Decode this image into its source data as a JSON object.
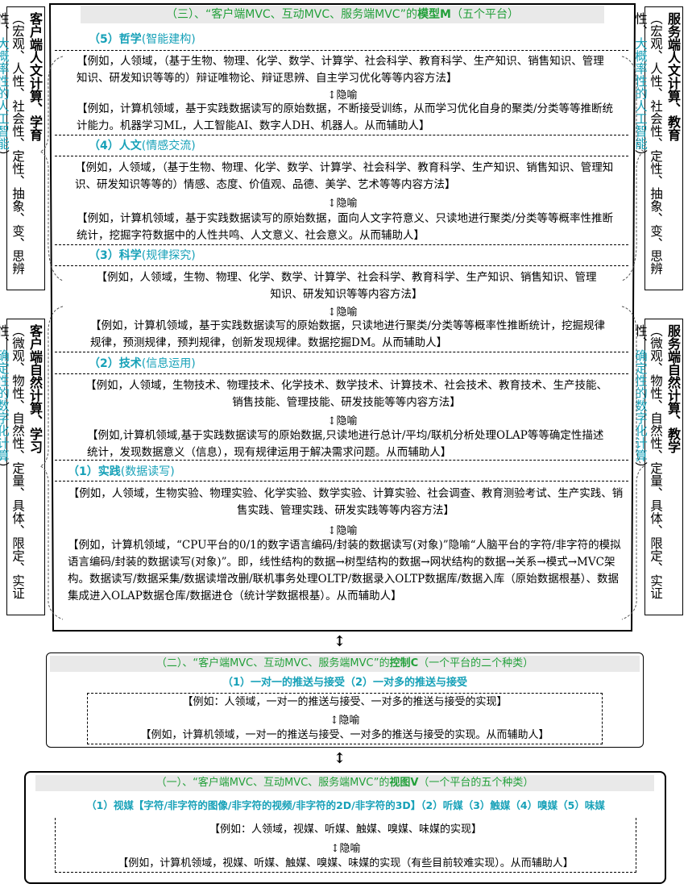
{
  "model": {
    "header_prefix": "（三）、“客户端MVC、互动MVC、服务端MVC”的",
    "header_bold": "模型M",
    "header_suffix": "（五个平台）",
    "sections": [
      {
        "num": "（5）",
        "title_bold": "哲学",
        "title_rest": "(智能建构)",
        "human": "【例如，人领域，（基于生物、物理、化学、数学、计算学、社会科学、教育科学、生产知识、销售知识、管理知识、研发知识等等的）辩证唯物论、辩证思辨、自主学习优化等等内容方法】",
        "metaphor": "隐喻",
        "computer": "【例如，计算机领域，基于实践数据读写的原始数据，不断接受训练，从而学习优化自身的聚类/分类等等推断统计能力。机器学习ML，人工智能AI、数字人DH、机器人。从而辅助人】"
      },
      {
        "num": "（4）",
        "title_bold": "人文",
        "title_rest": "(情感交流)",
        "human": "【例如，人领域，（基于生物、物理、化学、数学、计算学、社会科学、教育科学、生产知识、销售知识、管理知识、研发知识等等的）情感、态度、价值观、品德、美学、艺术等等内容方法】",
        "metaphor": "隐喻",
        "computer": "【例如，计算机领域，基于实践数据读写的原始数据，面向人文字符意义、只读地进行聚类/分类等等概率性推断统计，挖掘字符数据中的人性共鸣、人文意义、社会意义。从而辅助人】"
      },
      {
        "num": "（3）",
        "title_bold": "科学",
        "title_rest": "(规律探究)",
        "human": "【例如，人领域，生物、物理、化学、数学、计算学、社会科学、教育科学、生产知识、销售知识、管理知识、研发知识等等内容方法】",
        "metaphor": "隐喻",
        "computer": "【例如，计算机领域，基于实践数据读写的原始数据，只读地进行聚类/分类等等概率性推断统计，挖掘规律规律，预测规律，预判规律，创新发现规律。数据挖掘DM。从而辅助人】"
      },
      {
        "num": "（2）",
        "title_bold": "技术",
        "title_rest": "(信息运用)",
        "human": "【例如，人领域，生物技术、物理技术、化学技术、数学技术、计算技术、社会技术、教育技术、生产技能、销售技能、管理技能、研发技能等等内容方法】",
        "metaphor": "隐喻",
        "computer": "【例如,计算机领域,基于实践数据读写的原始数据,只读地进行总计/平均/联机分析处理OLAP等等确定性描述统计，发现数据意义（信息），现有规律运用于解决需求问题。从而辅助人】"
      },
      {
        "num": "（1）",
        "title_bold": "实践",
        "title_rest": "(数据读写)",
        "human": "【例如，人领域，生物实验、物理实验、化学实验、数学实验、计算实验、社会调查、教育测验考试、生产实践、销售实践、管理实践、研发实践等等内容方法】",
        "metaphor": "隐喻",
        "computer": "【例如，计算机领域，“CPU平台的0/1的数字语言编码/封装的数据读写(对象)”隐喻“人脑平台的字符/非字符的模拟语言编码/封装的数据读写(对象)”。即，线性结构的数据→树型结构的数据→网状结构的数据→关系→模式→MVC架构。数据读写/数据采集/数据读增改删/联机事务处理OLTP/数据录入OLTP数据库/数据入库（原始数据根基）、数据集成进入OLAP数据仓库/数据进仓（统计学数据根基）。从而辅助人】"
      }
    ]
  },
  "left_sidebars": [
    {
      "c1": "客户端人文计算、学育",
      "c2": "（宏观、人性、社会性、定性、抽象、变、思辨性、",
      "c3": "大概率性的人工智能",
      "c3_end": "）"
    },
    {
      "c1": "客户端自然计算、学习",
      "c2": "（微观、物性、自然性、定量、具体、限定、实证性、",
      "c3": "确定性的数字化计算",
      "c3_end": "）"
    }
  ],
  "right_sidebars": [
    {
      "c1": "服务端人文计算、教育",
      "c2": "（宏观、人性、社会性、定性、抽象、变、思辨性、",
      "c3": "大概率性的人工智能",
      "c3_end": "）"
    },
    {
      "c1": "服务端自然计算、教学",
      "c2": "（微观、物性、自然性、定量、具体、限定、实证性、",
      "c3": "确定性的数字化计算",
      "c3_end": "）"
    }
  ],
  "control": {
    "header_prefix": "（二）、“客户端MVC、互动MVC、服务端MVC”的",
    "header_bold": "控制C",
    "header_suffix": "（一个平台的二个种类）",
    "subtitle": "（1）一对一的推送与接受（2）一对多的推送与接受",
    "human": "【例如：人领域，一对一的推送与接受、一对多的推送与接受的实现】",
    "metaphor": "隐喻",
    "computer": "【例如，计算机领域，一对一的推送与接受、一对多的推送与接受的实现。从而辅助人】"
  },
  "view": {
    "header_prefix": "（一）、“客户端MVC、互动MVC、服务端MVC”的",
    "header_bold": "视图V",
    "header_suffix": "（一个平台的五个种类）",
    "subtitle": "（1）视媒【字符/非字符的图像/非字符的视频/非字符的2D/非字符的3D】（2）听媒（3）触媒（4）嗅媒（5）味媒",
    "human": "【例如：人领域，视媒、听媒、触媒、嗅媒、味媒的实现】",
    "metaphor": "隐喻",
    "computer": "【例如，计算机领域，视媒、听媒、触媒、嗅媒、味媒的实现（有些目前较难实现）。从而辅助人】"
  },
  "colors": {
    "green": "#23a03a",
    "teal": "#17a1b8",
    "header_bg": "#e8e8e8"
  }
}
